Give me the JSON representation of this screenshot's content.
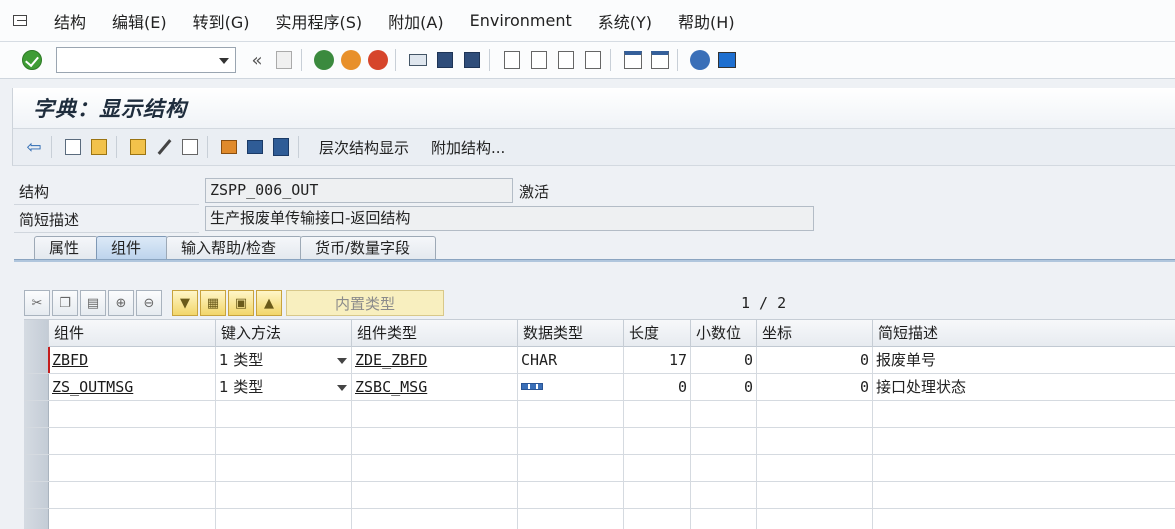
{
  "menu": {
    "items": [
      "结构",
      "编辑(E)",
      "转到(G)",
      "实用程序(S)",
      "附加(A)",
      "Environment",
      "系统(Y)",
      "帮助(H)"
    ]
  },
  "toolbar": {
    "command_value": "",
    "back_label": "«"
  },
  "title": "字典：显示结构",
  "app_toolbar": {
    "hierarchy_label": "层次结构显示",
    "append_label": "附加结构..."
  },
  "header": {
    "structure_label": "结构",
    "structure_value": "ZSPP_006_OUT",
    "status": "激活",
    "desc_label": "简短描述",
    "desc_value": "生产报废单传输接口-返回结构"
  },
  "tabs": [
    "属性",
    "组件",
    "输入帮助/检查",
    "货币/数量字段"
  ],
  "active_tab": "组件",
  "table_toolbar": {
    "builtin_label": "内置类型",
    "pager": "1 / 2"
  },
  "table": {
    "columns": [
      "组件",
      "键入方法",
      "组件类型",
      "数据类型",
      "长度",
      "小数位",
      "坐标",
      "简短描述"
    ],
    "rows": [
      {
        "component": "ZBFD",
        "method": "1 类型",
        "comp_type": "ZDE_ZBFD",
        "data_type": "CHAR",
        "length": "17",
        "decimals": "0",
        "coord": "0",
        "desc": "报废单号"
      },
      {
        "component": "ZS_OUTMSG",
        "method": "1 类型",
        "comp_type": "ZSBC_MSG",
        "data_type": "",
        "length": "0",
        "decimals": "0",
        "coord": "0",
        "desc": "接口处理状态"
      }
    ]
  }
}
